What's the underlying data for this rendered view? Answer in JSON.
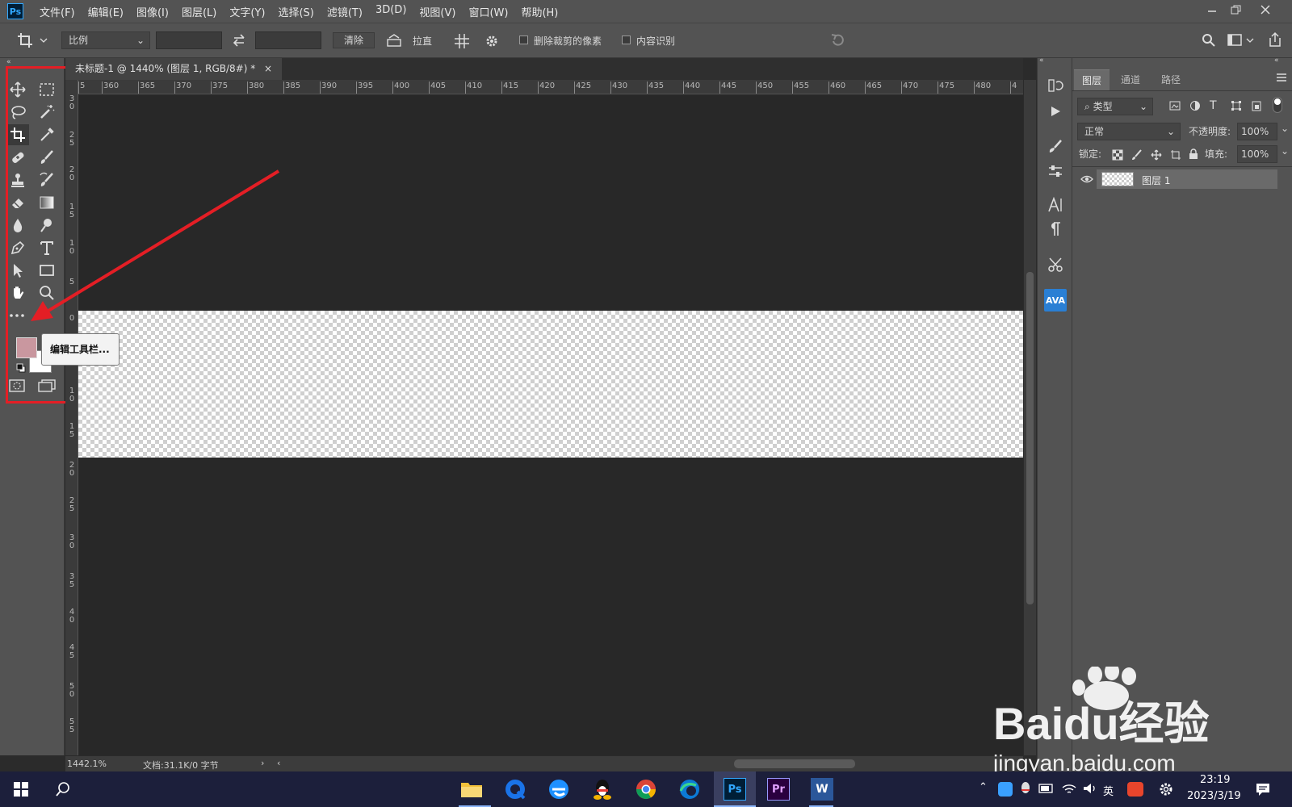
{
  "app": {
    "logo_text": "Ps"
  },
  "menu": [
    "文件(F)",
    "编辑(E)",
    "图像(I)",
    "图层(L)",
    "文字(Y)",
    "选择(S)",
    "滤镜(T)",
    "3D(D)",
    "视图(V)",
    "窗口(W)",
    "帮助(H)"
  ],
  "options_bar": {
    "ratio_label": "比例",
    "clear_button": "清除",
    "straighten_label": "拉直",
    "delete_cropped_label": "删除裁剪的像素",
    "content_aware_label": "内容识别"
  },
  "document": {
    "tab_title": "未标题-1 @ 1440% (图层 1, RGB/8#) *",
    "zoom": "1442.1%",
    "doc_info": "文档:31.1K/0 字节"
  },
  "ruler": {
    "h_labels": [
      "5",
      "360",
      "365",
      "370",
      "375",
      "380",
      "385",
      "390",
      "395",
      "400",
      "405",
      "410",
      "415",
      "420",
      "425",
      "430",
      "435",
      "440",
      "445",
      "450",
      "455",
      "460",
      "465",
      "470",
      "475",
      "480",
      "4"
    ],
    "v_labels": [
      "3\n0",
      "2\n5",
      "2\n0",
      "1\n5",
      "1\n0",
      "5",
      "0",
      "5",
      "1\n0",
      "1\n5",
      "2\n0",
      "2\n5",
      "3\n0",
      "3\n5",
      "4\n0",
      "4\n5",
      "5\n0",
      "5\n5"
    ]
  },
  "tooltip": "编辑工具栏...",
  "colors": {
    "foreground": "#c9979f",
    "background": "#ffffff",
    "annotation": "#e41e25",
    "accent": "#31a8ff"
  },
  "layers_panel": {
    "tabs": [
      "图层",
      "通道",
      "路径"
    ],
    "filter_label": "类型",
    "blend_mode": "正常",
    "opacity_label": "不透明度:",
    "opacity_value": "100%",
    "lock_label": "锁定:",
    "fill_label": "填充:",
    "fill_value": "100%",
    "layers": [
      {
        "name": "图层 1"
      }
    ]
  },
  "watermark": {
    "brand": "Baidu经验",
    "url": "jingyan.baidu.com"
  },
  "taskbar": {
    "ime": "英",
    "time": "23:19",
    "date": "2023/3/19"
  }
}
